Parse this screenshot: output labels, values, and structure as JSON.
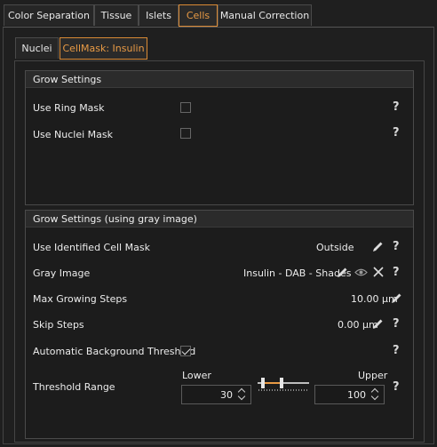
{
  "top_tabs": [
    "Color Separation",
    "Tissue",
    "Islets",
    "Cells",
    "Manual Correction"
  ],
  "top_tabs_active": "Cells",
  "sub_tabs": [
    "Nuclei",
    "CellMask: Insulin"
  ],
  "sub_tabs_active": "CellMask: Insulin",
  "grow_settings": {
    "title": "Grow Settings",
    "use_ring_mask_label": "Use Ring Mask",
    "use_ring_mask_checked": false,
    "use_nuclei_mask_label": "Use Nuclei Mask",
    "use_nuclei_mask_checked": false
  },
  "grow_gray": {
    "title": "Grow Settings (using gray image)",
    "identified_cell_mask_label": "Use Identified Cell Mask",
    "identified_cell_mask_value": "Outside",
    "gray_image_label": "Gray Image",
    "gray_image_value": "Insulin - DAB - Shades",
    "max_growing_steps_label": "Max Growing Steps",
    "max_growing_steps_value": "10.00 µm",
    "skip_steps_label": "Skip Steps",
    "skip_steps_value": "0.00 µm",
    "auto_bg_threshold_label": "Automatic Background Threshold",
    "auto_bg_threshold_checked": true,
    "threshold_range_label": "Threshold Range",
    "lower_label": "Lower",
    "upper_label": "Upper",
    "lower_value": "30",
    "upper_value": "100"
  },
  "help_symbol": "?",
  "colors": {
    "accent": "#e89a45",
    "background": "#1f1f1f",
    "panel": "#1c1c1c"
  },
  "icons": [
    "pencil-icon",
    "eye-icon",
    "close-icon",
    "help-icon",
    "checkbox-icon",
    "range-slider"
  ]
}
